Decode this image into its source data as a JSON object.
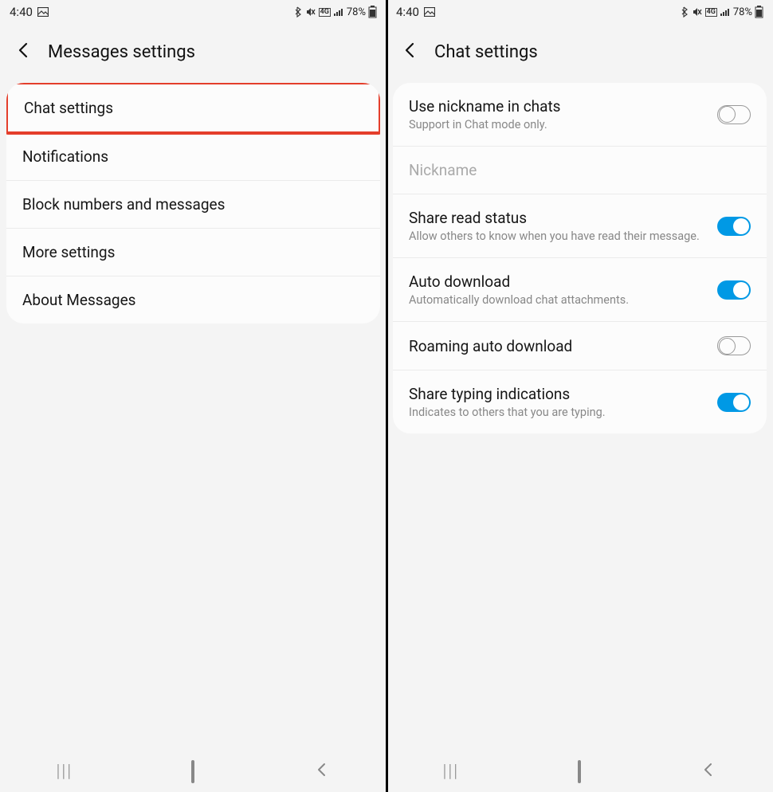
{
  "status": {
    "time": "4:40",
    "battery": "78%",
    "network_label": "4G"
  },
  "left": {
    "title": "Messages settings",
    "items": [
      {
        "label": "Chat settings"
      },
      {
        "label": "Notifications"
      },
      {
        "label": "Block numbers and messages"
      },
      {
        "label": "More settings"
      },
      {
        "label": "About Messages"
      }
    ]
  },
  "right": {
    "title": "Chat settings",
    "items": [
      {
        "label": "Use nickname in chats",
        "sub": "Support in Chat mode only.",
        "toggle": "off"
      },
      {
        "label": "Nickname",
        "disabled": true
      },
      {
        "label": "Share read status",
        "sub": "Allow others to know when you have read their message.",
        "toggle": "on"
      },
      {
        "label": "Auto download",
        "sub": "Automatically download chat attachments.",
        "toggle": "on"
      },
      {
        "label": "Roaming auto download",
        "toggle": "off"
      },
      {
        "label": "Share typing indications",
        "sub": "Indicates to others that you are typing.",
        "toggle": "on"
      }
    ]
  }
}
